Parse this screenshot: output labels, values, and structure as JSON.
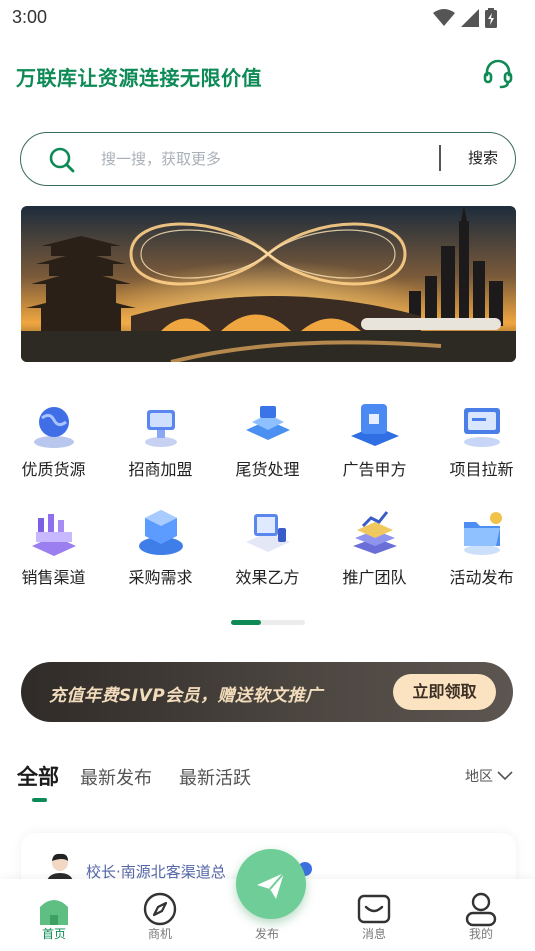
{
  "status_bar": {
    "time": "3:00"
  },
  "header": {
    "title": "万联库让资源连接无限价值",
    "support_icon": "headset-icon"
  },
  "search": {
    "placeholder": "搜一搜，获取更多",
    "button_label": "搜索",
    "icon": "search-icon"
  },
  "banner": {
    "image": "infinity-bridge-city-banner"
  },
  "categories": [
    {
      "label": "优质货源",
      "icon": "globe-3d-icon"
    },
    {
      "label": "招商加盟",
      "icon": "monitor-3d-icon"
    },
    {
      "label": "尾货处理",
      "icon": "platform-3d-icon"
    },
    {
      "label": "广告甲方",
      "icon": "thumbs-up-3d-icon"
    },
    {
      "label": "项目拉新",
      "icon": "dashboard-3d-icon"
    },
    {
      "label": "销售渠道",
      "icon": "factory-3d-icon"
    },
    {
      "label": "采购需求",
      "icon": "cube-3d-icon"
    },
    {
      "label": "效果乙方",
      "icon": "devices-3d-icon"
    },
    {
      "label": "推广团队",
      "icon": "books-chart-3d-icon"
    },
    {
      "label": "活动发布",
      "icon": "folder-3d-icon"
    }
  ],
  "pager": {
    "active_page": 1,
    "total_pages": 2
  },
  "promo": {
    "text": "充值年费SIVP会员，赠送软文推广",
    "button_label": "立即领取"
  },
  "feed_tabs": {
    "items": [
      "全部",
      "最新发布",
      "最新活跃"
    ],
    "active": "全部",
    "region_label": "地区"
  },
  "feed": {
    "first_item": {
      "author": "校长·南源北客渠道总"
    }
  },
  "tabbar": {
    "items": [
      {
        "label": "首页",
        "icon": "home-icon",
        "active": true
      },
      {
        "label": "商机",
        "icon": "compass-icon",
        "active": false
      },
      {
        "label": "发布",
        "icon": "send-icon",
        "active": false
      },
      {
        "label": "消息",
        "icon": "message-icon",
        "active": false
      },
      {
        "label": "我的",
        "icon": "user-icon",
        "active": false
      }
    ]
  },
  "colors": {
    "brand": "#0d8a55",
    "publish": "#6fce98",
    "promo_accent": "#fbe2c1"
  }
}
